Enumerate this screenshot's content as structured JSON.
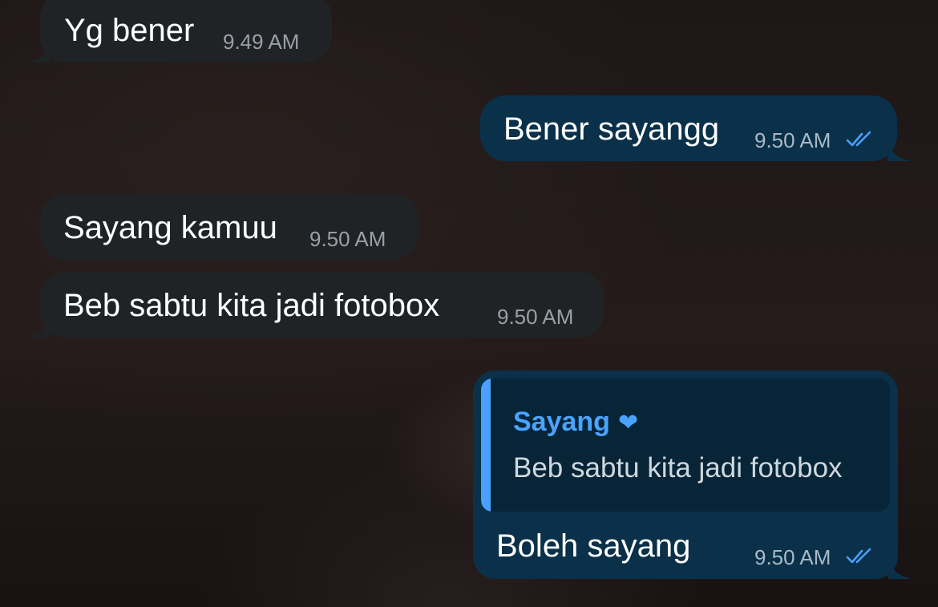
{
  "chat": {
    "messages": [
      {
        "direction": "incoming",
        "text": "Yg bener",
        "time": "9.49 AM"
      },
      {
        "direction": "outgoing",
        "text": "Bener sayangg",
        "time": "9.50 AM",
        "status": "read"
      },
      {
        "direction": "incoming",
        "text": "Sayang kamuu",
        "time": "9.50 AM"
      },
      {
        "direction": "incoming",
        "text": "Beb sabtu kita jadi fotobox",
        "time": "9.50 AM"
      },
      {
        "direction": "outgoing",
        "text": "Boleh sayang",
        "time": "9.50 AM",
        "status": "read",
        "reply_to": {
          "name": "Sayang",
          "name_emoji": "❤",
          "text": "Beb sabtu kita jadi fotobox"
        }
      }
    ]
  },
  "colors": {
    "incoming_bubble": "#1f2326",
    "outgoing_bubble": "#0a3149",
    "quote_background": "#072537",
    "accent": "#4aa3ff",
    "read_check": "#4a9fff"
  },
  "icons": {
    "read_receipt": "double-check-icon",
    "quote_emoji": "heart-icon"
  }
}
